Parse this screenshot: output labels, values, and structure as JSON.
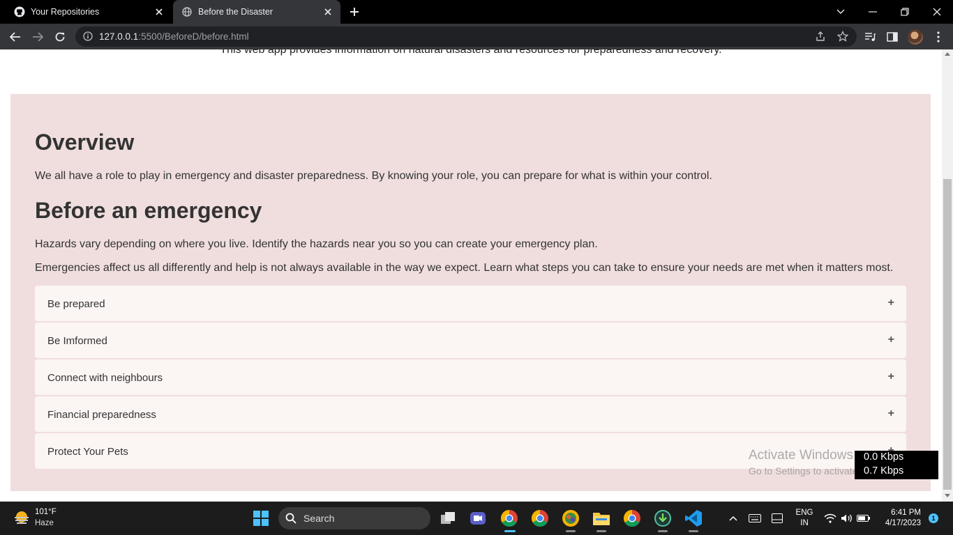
{
  "browser": {
    "tabs": [
      {
        "title": "Your Repositories",
        "icon": "github-icon"
      },
      {
        "title": "Before the Disaster",
        "icon": "globe-icon",
        "active": true
      }
    ],
    "url": {
      "host": "127.0.0.1",
      "rest": ":5500/BeforeD/before.html"
    }
  },
  "page": {
    "intro": "This web app provides information on natural disasters and resources for preparedness and recovery.",
    "overview_heading": "Overview",
    "overview_text": "We all have a role to play in emergency and disaster preparedness. By knowing your role, you can prepare for what is within your control.",
    "before_heading": "Before an emergency",
    "before_p1": "Hazards vary depending on where you live. Identify the hazards near you so you can create your emergency plan.",
    "before_p2": "Emergencies affect us all differently and help is not always available in the way we expect. Learn what steps you can take to ensure your needs are met when it matters most.",
    "accordion": [
      {
        "label": "Be prepared",
        "toggle": "+"
      },
      {
        "label": "Be Imformed",
        "toggle": "+"
      },
      {
        "label": "Connect with neighbours",
        "toggle": "+"
      },
      {
        "label": "Financial preparedness",
        "toggle": "+"
      },
      {
        "label": "Protect Your Pets",
        "toggle": "+"
      }
    ],
    "section_bg": "#f0dede"
  },
  "overlay": {
    "watermark_title": "Activate Windows",
    "watermark_sub": "Go to Settings to activate Windows.",
    "net_up": "0.0 Kbps",
    "net_down": "0.7 Kbps"
  },
  "taskbar": {
    "temperature": "101°F",
    "condition": "Haze",
    "search_label": "Search",
    "lang_1": "ENG",
    "lang_2": "IN",
    "time": "6:41 PM",
    "date": "4/17/2023",
    "notification_count": "1"
  }
}
